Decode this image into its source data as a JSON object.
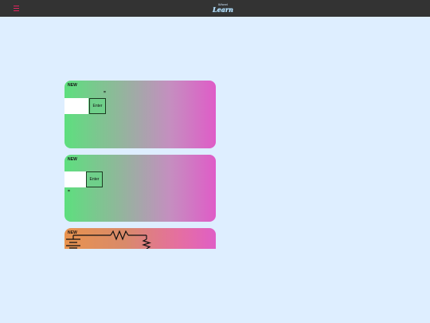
{
  "header": {
    "menu_icon": "hamburger-menu-icon",
    "logo_small": "Wheel",
    "logo_big": "Learn",
    "menu_color": "#e0245e"
  },
  "cards": [
    {
      "badge": "NEW",
      "symbol": "=",
      "input_value": "",
      "button_label": "Enter",
      "gradient": [
        "#5ddf7e",
        "#df5cc7"
      ]
    },
    {
      "badge": "NEW",
      "symbol": "=",
      "input_value": "",
      "button_label": "Enter",
      "gradient": [
        "#5ddf7e",
        "#df5cc7"
      ]
    },
    {
      "badge": "NEW",
      "diagram": "circuit-diagram",
      "gradient": [
        "#e8934e",
        "#e05fc5"
      ]
    }
  ]
}
